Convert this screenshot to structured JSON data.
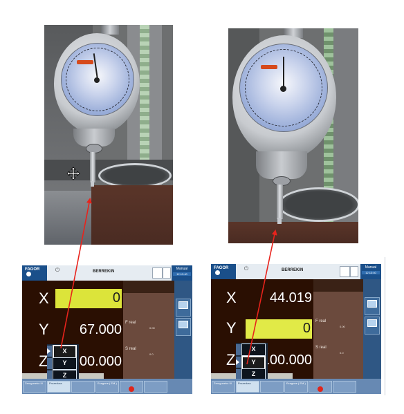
{
  "left_screen": {
    "brand": "FAGOR",
    "mode_title": "BERREKIN",
    "manual": "Manual",
    "clock": "12:13:40",
    "axes": [
      {
        "label": "X",
        "value": "0"
      },
      {
        "label": "Y",
        "value": "67.000"
      },
      {
        "label": "Z",
        "value": "100.000"
      }
    ],
    "popup": [
      {
        "label": "X",
        "selected": true
      },
      {
        "label": "Y",
        "selected": false
      },
      {
        "label": "Z",
        "selected": false
      }
    ],
    "bottom_keys": [
      "Zeroguneko III",
      "Prozedura",
      "",
      "Ezagune ( EM )",
      ""
    ],
    "info": {
      "f_real": "F real",
      "s_real": "S real",
      "f_prog": "0.00",
      "s_prog": "0.0"
    }
  },
  "right_screen": {
    "brand": "FAGOR",
    "mode_title": "BERREKIN",
    "manual": "Manual",
    "clock": "12:13:40",
    "axes": [
      {
        "label": "X",
        "value": "44.019"
      },
      {
        "label": "Y",
        "value": "0"
      },
      {
        "label": "Z",
        "value": "100.000"
      }
    ],
    "popup": [
      {
        "label": "X",
        "selected": false
      },
      {
        "label": "Y",
        "selected": true
      },
      {
        "label": "Z",
        "selected": false
      }
    ],
    "bottom_keys": [
      "Zeroguneko III",
      "Prozedura",
      "",
      "Ezagune ( EM )",
      ""
    ],
    "info": {
      "f_real": "F real",
      "s_real": "S real",
      "f_prog": "0.00",
      "s_prog": "0.0"
    }
  },
  "colors": {
    "arrow": "#e8231c",
    "yellow": "#dce43a",
    "screen_blue": "#1a4f8a"
  },
  "icons": [
    "move-cursor-icon",
    "power-icon",
    "arrow-right-icon"
  ]
}
